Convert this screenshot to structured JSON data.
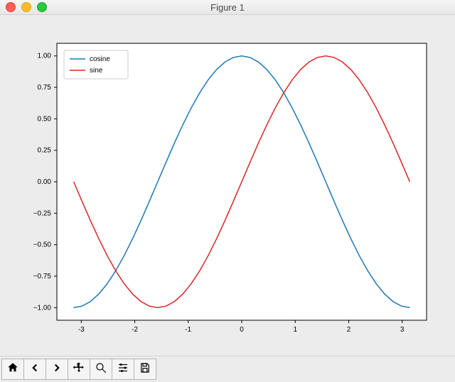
{
  "window": {
    "title": "Figure 1"
  },
  "toolbar": {
    "home": "Home",
    "back": "Back",
    "forward": "Forward",
    "pan": "Pan",
    "zoom": "Zoom",
    "configure": "Configure subplots",
    "save": "Save"
  },
  "chart_data": {
    "type": "line",
    "xlim": [
      -3.14159,
      3.14159
    ],
    "ylim": [
      -1.0,
      1.0
    ],
    "xticks": [
      -3,
      -2,
      -1,
      0,
      1,
      2,
      3
    ],
    "yticks": [
      -1.0,
      -0.75,
      -0.5,
      -0.25,
      0.0,
      0.25,
      0.5,
      0.75,
      1.0
    ],
    "legend_position": "upper left",
    "series": [
      {
        "name": "cosine",
        "color": "#1f77b4",
        "x": [
          -3.1416,
          -2.9845,
          -2.8274,
          -2.6704,
          -2.5133,
          -2.3562,
          -2.1991,
          -2.042,
          -1.885,
          -1.7279,
          -1.5708,
          -1.4137,
          -1.2566,
          -1.0996,
          -0.9425,
          -0.7854,
          -0.6283,
          -0.4712,
          -0.3142,
          -0.1571,
          0.0,
          0.1571,
          0.3142,
          0.4712,
          0.6283,
          0.7854,
          0.9425,
          1.0996,
          1.2566,
          1.4137,
          1.5708,
          1.7279,
          1.885,
          2.042,
          2.1991,
          2.3562,
          2.5133,
          2.6704,
          2.8274,
          2.9845,
          3.1416
        ],
        "y": [
          -1.0,
          -0.9877,
          -0.9511,
          -0.891,
          -0.809,
          -0.7071,
          -0.5878,
          -0.454,
          -0.309,
          -0.1564,
          0.0,
          0.1564,
          0.309,
          0.454,
          0.5878,
          0.7071,
          0.809,
          0.891,
          0.9511,
          0.9877,
          1.0,
          0.9877,
          0.9511,
          0.891,
          0.809,
          0.7071,
          0.5878,
          0.454,
          0.309,
          0.1564,
          0.0,
          -0.1564,
          -0.309,
          -0.454,
          -0.5878,
          -0.7071,
          -0.809,
          -0.891,
          -0.9511,
          -0.9877,
          -1.0
        ]
      },
      {
        "name": "sine",
        "color": "#d62728",
        "x": [
          -3.1416,
          -2.9845,
          -2.8274,
          -2.6704,
          -2.5133,
          -2.3562,
          -2.1991,
          -2.042,
          -1.885,
          -1.7279,
          -1.5708,
          -1.4137,
          -1.2566,
          -1.0996,
          -0.9425,
          -0.7854,
          -0.6283,
          -0.4712,
          -0.3142,
          -0.1571,
          0.0,
          0.1571,
          0.3142,
          0.4712,
          0.6283,
          0.7854,
          0.9425,
          1.0996,
          1.2566,
          1.4137,
          1.5708,
          1.7279,
          1.885,
          2.042,
          2.1991,
          2.3562,
          2.5133,
          2.6704,
          2.8274,
          2.9845,
          3.1416
        ],
        "y": [
          0.0,
          -0.1564,
          -0.309,
          -0.454,
          -0.5878,
          -0.7071,
          -0.809,
          -0.891,
          -0.9511,
          -0.9877,
          -1.0,
          -0.9877,
          -0.9511,
          -0.891,
          -0.809,
          -0.7071,
          -0.5878,
          -0.454,
          -0.309,
          -0.1564,
          0.0,
          0.1564,
          0.309,
          0.454,
          0.5878,
          0.7071,
          0.809,
          0.891,
          0.9511,
          0.9877,
          1.0,
          0.9877,
          0.9511,
          0.891,
          0.809,
          0.7071,
          0.5878,
          0.454,
          0.309,
          0.1564,
          0.0
        ]
      }
    ]
  }
}
